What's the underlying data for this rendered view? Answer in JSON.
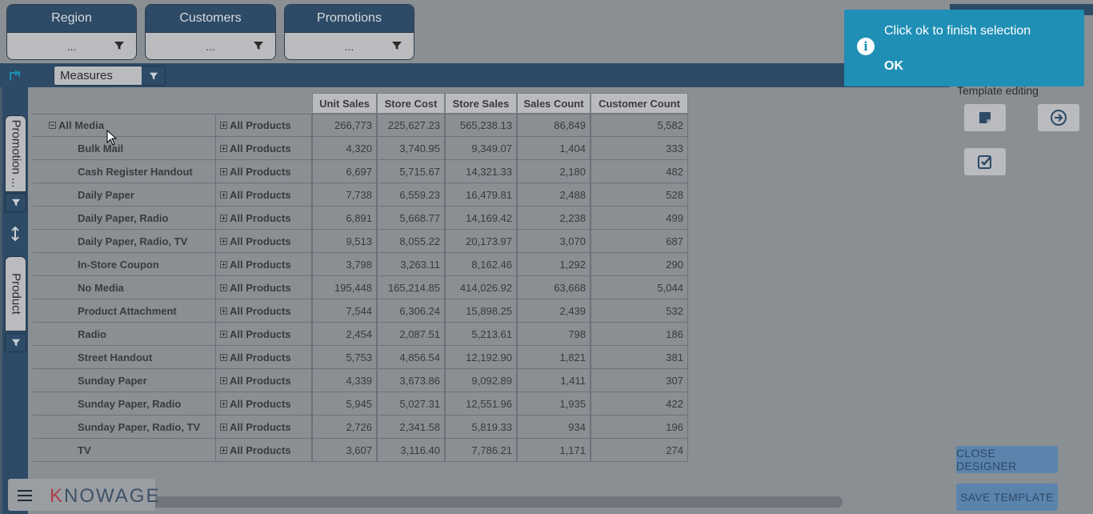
{
  "filters": [
    {
      "label": "Region",
      "value": "..."
    },
    {
      "label": "Customers",
      "value": "..."
    },
    {
      "label": "Promotions",
      "value": "..."
    }
  ],
  "measures": {
    "label": "Measures"
  },
  "vertical": {
    "promotion": "Promotion ...",
    "product": "Product"
  },
  "table": {
    "headers": [
      "Unit Sales",
      "Store Cost",
      "Store Sales",
      "Sales Count",
      "Customer Count"
    ],
    "root_label": "All Media",
    "product_label": "All Products",
    "root_values": [
      "266,773",
      "225,627.23",
      "565,238.13",
      "86,849",
      "5,582"
    ],
    "rows": [
      {
        "name": "Bulk Mail",
        "values": [
          "4,320",
          "3,740.95",
          "9,349.07",
          "1,404",
          "333"
        ]
      },
      {
        "name": "Cash Register Handout",
        "values": [
          "6,697",
          "5,715.67",
          "14,321.33",
          "2,180",
          "482"
        ]
      },
      {
        "name": "Daily Paper",
        "values": [
          "7,738",
          "6,559.23",
          "16,479.81",
          "2,488",
          "528"
        ]
      },
      {
        "name": "Daily Paper, Radio",
        "values": [
          "6,891",
          "5,668.77",
          "14,169.42",
          "2,238",
          "499"
        ]
      },
      {
        "name": "Daily Paper, Radio, TV",
        "values": [
          "9,513",
          "8,055.22",
          "20,173.97",
          "3,070",
          "687"
        ]
      },
      {
        "name": "In-Store Coupon",
        "values": [
          "3,798",
          "3,263.11",
          "8,162.46",
          "1,292",
          "290"
        ]
      },
      {
        "name": "No Media",
        "values": [
          "195,448",
          "165,214.85",
          "414,026.92",
          "63,668",
          "5,044"
        ]
      },
      {
        "name": "Product Attachment",
        "values": [
          "7,544",
          "6,306.24",
          "15,898.25",
          "2,439",
          "532"
        ]
      },
      {
        "name": "Radio",
        "values": [
          "2,454",
          "2,087.51",
          "5,213.61",
          "798",
          "186"
        ]
      },
      {
        "name": "Street Handout",
        "values": [
          "5,753",
          "4,856.54",
          "12,192.90",
          "1,821",
          "381"
        ]
      },
      {
        "name": "Sunday Paper",
        "values": [
          "4,339",
          "3,673.86",
          "9,092.89",
          "1,411",
          "307"
        ]
      },
      {
        "name": "Sunday Paper, Radio",
        "values": [
          "5,945",
          "5,027.31",
          "12,551.96",
          "1,935",
          "422"
        ]
      },
      {
        "name": "Sunday Paper, Radio, TV",
        "values": [
          "2,726",
          "2,341.58",
          "5,819.33",
          "934",
          "196"
        ]
      },
      {
        "name": "TV",
        "values": [
          "3,607",
          "3,116.40",
          "7,786.21",
          "1,171",
          "274"
        ]
      }
    ]
  },
  "panel": {
    "template_label": "Template editing",
    "close_designer": "CLOSE DESIGNER",
    "save_template": "SAVE TEMPLATE"
  },
  "toast": {
    "message": "Click ok to finish selection",
    "ok": "OK",
    "icon": "info-icon"
  },
  "brand": {
    "logo_k": "K",
    "logo_rest": "NOWAGE"
  },
  "colors": {
    "header_dark": "#2d4a66",
    "toast_bg": "#1f8fb5",
    "button_blue": "#5b84ad",
    "logo_red": "#b13d4e"
  }
}
